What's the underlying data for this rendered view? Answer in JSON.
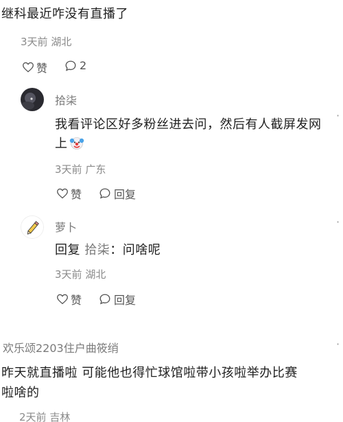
{
  "comment": {
    "text": "继科最近咋没有直播了",
    "time": "3天前",
    "location": "湖北",
    "like_label": "赞",
    "reply_count": "2"
  },
  "reply1": {
    "user": "拾柒",
    "text_line1": "我看评论区好多粉丝进去问，然后有人截屏发网",
    "text_line2": "上",
    "emoji": "clown-face-icon",
    "time": "3天前",
    "location": "广东",
    "like_label": "赞",
    "reply_label": "回复"
  },
  "reply2": {
    "user": "萝卜",
    "reply_prefix": "回复",
    "reply_to": "拾柒",
    "text": "：问啥呢",
    "time": "3天前",
    "location": "湖北",
    "like_label": "赞",
    "reply_label": "回复",
    "more": "·"
  },
  "comment2": {
    "user": "欢乐颂2203住户曲筱绡",
    "text_line1": "昨天就直播啦 可能他也得忙球馆啦带小孩啦举办比赛",
    "text_line2": "啦啥的",
    "time": "2天前",
    "location": "吉林"
  },
  "more_glyph": "·"
}
